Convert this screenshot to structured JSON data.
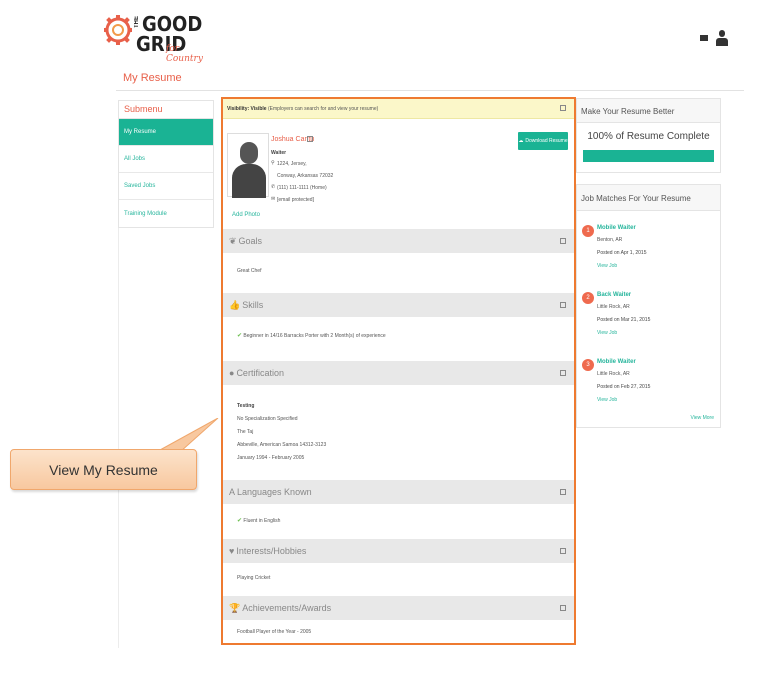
{
  "brand": {
    "the": "THE",
    "good": "GOOD",
    "grid": "GRID",
    "tagline": "for Country"
  },
  "page": {
    "title": "My Resume"
  },
  "sidebar": {
    "heading": "Submenu",
    "items": [
      {
        "label": "My Resume",
        "active": true
      },
      {
        "label": "All Jobs",
        "active": false
      },
      {
        "label": "Saved Jobs",
        "active": false
      },
      {
        "label": "Training Module",
        "active": false
      }
    ]
  },
  "visibility": {
    "label": "Visibility: Visible",
    "note": "(Employers can search for and view your resume)"
  },
  "profile": {
    "name": "Joshua Cantu",
    "job": "Waiter",
    "address1": "1224, Jersey,",
    "address2": "Conway, Arkansas 72032",
    "phone": "(111) 111-1111 (Home)",
    "email": "[email protected]",
    "add_photo": "Add Photo",
    "download": "Download Resume"
  },
  "sections": {
    "goals": {
      "title": "Goals",
      "text": "Great Chef"
    },
    "skills": {
      "title": "Skills",
      "text": "Beginner in 14/16 Barracks Porter with 2  Month(s) of experience"
    },
    "certification": {
      "title": "Certification",
      "name": "Testing",
      "lines": [
        "No Specialization Specified",
        "The Taj",
        "Abbeville, American Samoa  14312-3123",
        "January 1994 - February 2005"
      ]
    },
    "languages": {
      "title": "Languages Known",
      "text": "Fluent in English"
    },
    "interests": {
      "title": "Interests/Hobbies",
      "text": "Playing Cricket"
    },
    "achievements": {
      "title": "Achievements/Awards",
      "text": "Football Player of the Year - 2005"
    }
  },
  "resume_better": {
    "heading": "Make Your Resume Better",
    "complete": "100% of Resume Complete",
    "progress": 1.0
  },
  "job_matches": {
    "heading": "Job Matches For Your Resume",
    "jobs": [
      {
        "num": "1",
        "title": "Mobile Waiter",
        "location": "Benton, AR",
        "posted": "Posted on Apr 1, 2015",
        "view": "View Job"
      },
      {
        "num": "2",
        "title": "Back Waiter",
        "location": "Little Rock, AR",
        "posted": "Posted on Mar 21, 2015",
        "view": "View Job"
      },
      {
        "num": "3",
        "title": "Mobile Waiter",
        "location": "Little Rock, AR",
        "posted": "Posted on Feb 27, 2015",
        "view": "View Job"
      }
    ],
    "view_more": "View More"
  },
  "callout": {
    "text": "View My Resume"
  },
  "colors": {
    "accent": "#1ab394",
    "brand": "#e8604a",
    "highlight": "#ee7a30"
  }
}
